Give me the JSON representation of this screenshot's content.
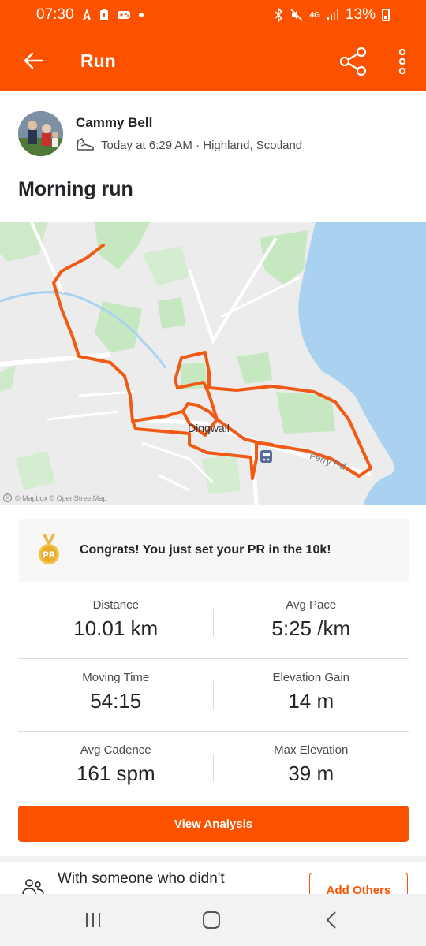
{
  "status_bar": {
    "time": "07:30",
    "network": "4G",
    "battery": "13%"
  },
  "app_bar": {
    "title": "Run"
  },
  "activity": {
    "athlete_name": "Cammy Bell",
    "datetime_location": "Today at 6:29 AM · Highland, Scotland",
    "title": "Morning run"
  },
  "map": {
    "town_label": "Dingwall",
    "road_label": "Ferry Rd",
    "attribution": "© Mapbox © OpenStreetMap"
  },
  "pr_banner": {
    "badge": "PR",
    "text": "Congrats! You just set your PR in the 10k!"
  },
  "stats": [
    [
      {
        "label": "Distance",
        "value": "10.01 km"
      },
      {
        "label": "Avg Pace",
        "value": "5:25 /km"
      }
    ],
    [
      {
        "label": "Moving Time",
        "value": "54:15"
      },
      {
        "label": "Elevation Gain",
        "value": "14 m"
      }
    ],
    [
      {
        "label": "Avg Cadence",
        "value": "161 spm"
      },
      {
        "label": "Max Elevation",
        "value": "39 m"
      }
    ]
  ],
  "buttons": {
    "view_analysis": "View Analysis",
    "add_others": "Add Others"
  },
  "others_prompt": "With someone who didn't",
  "colors": {
    "brand": "#fc5200",
    "route": "#f05a14",
    "water": "#a9d2f0",
    "park": "#c6e8c0"
  },
  "icons": {
    "back": "arrow-left-icon",
    "share": "share-icon",
    "more": "more-vertical-icon",
    "shoe": "shoe-icon",
    "medal": "medal-icon",
    "people": "people-icon"
  }
}
